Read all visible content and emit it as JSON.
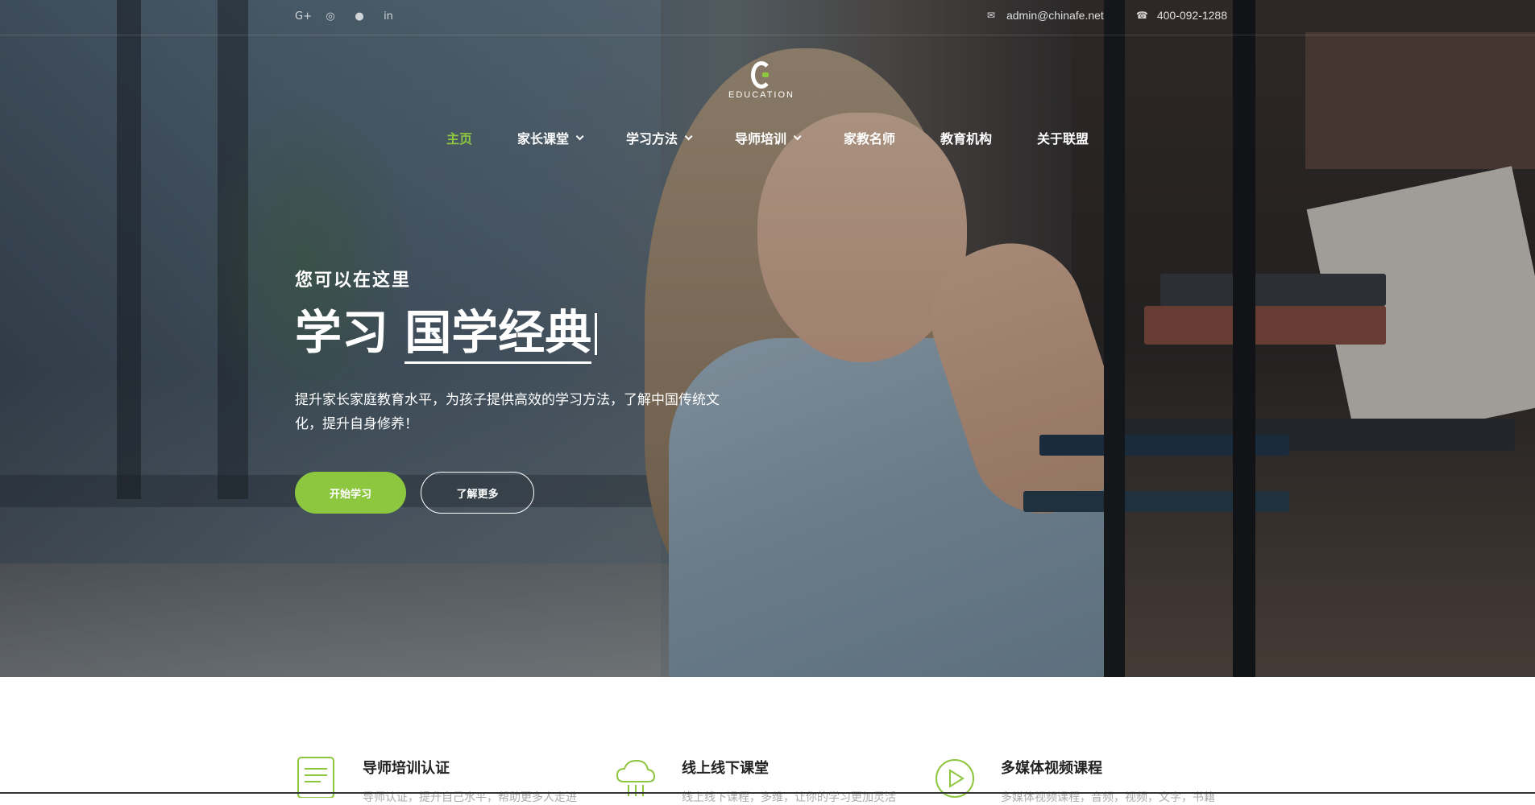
{
  "topbar": {
    "socials": [
      {
        "icon": "google-plus-icon",
        "glyph": "G+"
      },
      {
        "icon": "weibo-icon",
        "glyph": "◎"
      },
      {
        "icon": "github-icon",
        "glyph": "●"
      },
      {
        "icon": "linkedin-icon",
        "glyph": "in"
      }
    ],
    "email": "admin@chinafe.net",
    "phone": "400-092-1288"
  },
  "logo": {
    "text": "EDUCATION"
  },
  "nav": {
    "items": [
      {
        "label": "主页",
        "active": true,
        "dropdown": false
      },
      {
        "label": "家长课堂",
        "active": false,
        "dropdown": true
      },
      {
        "label": "学习方法",
        "active": false,
        "dropdown": true
      },
      {
        "label": "导师培训",
        "active": false,
        "dropdown": true
      },
      {
        "label": "家教名师",
        "active": false,
        "dropdown": false
      },
      {
        "label": "教育机构",
        "active": false,
        "dropdown": false
      },
      {
        "label": "关于联盟",
        "active": false,
        "dropdown": false
      }
    ]
  },
  "hero": {
    "subtitle": "您可以在这里",
    "headline_prefix": "学习",
    "headline_highlight": "国学经典",
    "description": "提升家长家庭教育水平，为孩子提供高效的学习方法，了解中国传统文化，提升自身修养！",
    "primary_button": "开始学习",
    "secondary_button": "了解更多"
  },
  "features": [
    {
      "title": "导师培训认证",
      "desc": "导师认证，提升自己水平，帮助更多人走进",
      "icon": "certificate-icon"
    },
    {
      "title": "线上线下课堂",
      "desc": "线上线下课程，多维，让你的学习更加灵活",
      "icon": "cloud-icon"
    },
    {
      "title": "多媒体视频课程",
      "desc": "多媒体视频课程，音频，视频，文字，书籍",
      "icon": "play-icon"
    }
  ],
  "colors": {
    "accent": "#8dc63f",
    "text": "#222222",
    "muted": "#aaaaaa"
  }
}
